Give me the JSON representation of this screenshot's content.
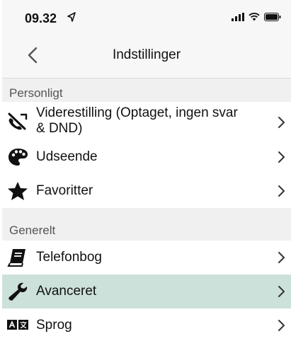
{
  "status": {
    "time": "09.32"
  },
  "nav": {
    "title": "Indstillinger"
  },
  "sections": [
    {
      "header": "Personligt"
    },
    {
      "header": "Generelt"
    }
  ],
  "rows": [
    {
      "label": "Viderestilling (Optaget, ingen svar & DND)",
      "line1": "Viderestilling (Optaget, ingen svar",
      "line2": "& DND)",
      "icon": "call-forwarding-icon"
    },
    {
      "label": "Udseende",
      "icon": "palette-icon"
    },
    {
      "label": "Favoritter",
      "icon": "star-icon"
    },
    {
      "label": "Telefonbog",
      "icon": "book-icon"
    },
    {
      "label": "Avanceret",
      "icon": "wrench-icon",
      "selected": true
    },
    {
      "label": "Sprog",
      "icon": "language-icon"
    }
  ],
  "colors": {
    "selected_row": "#cde1db",
    "section_bg": "#f0f0f0",
    "background": "#f7f7f7"
  }
}
